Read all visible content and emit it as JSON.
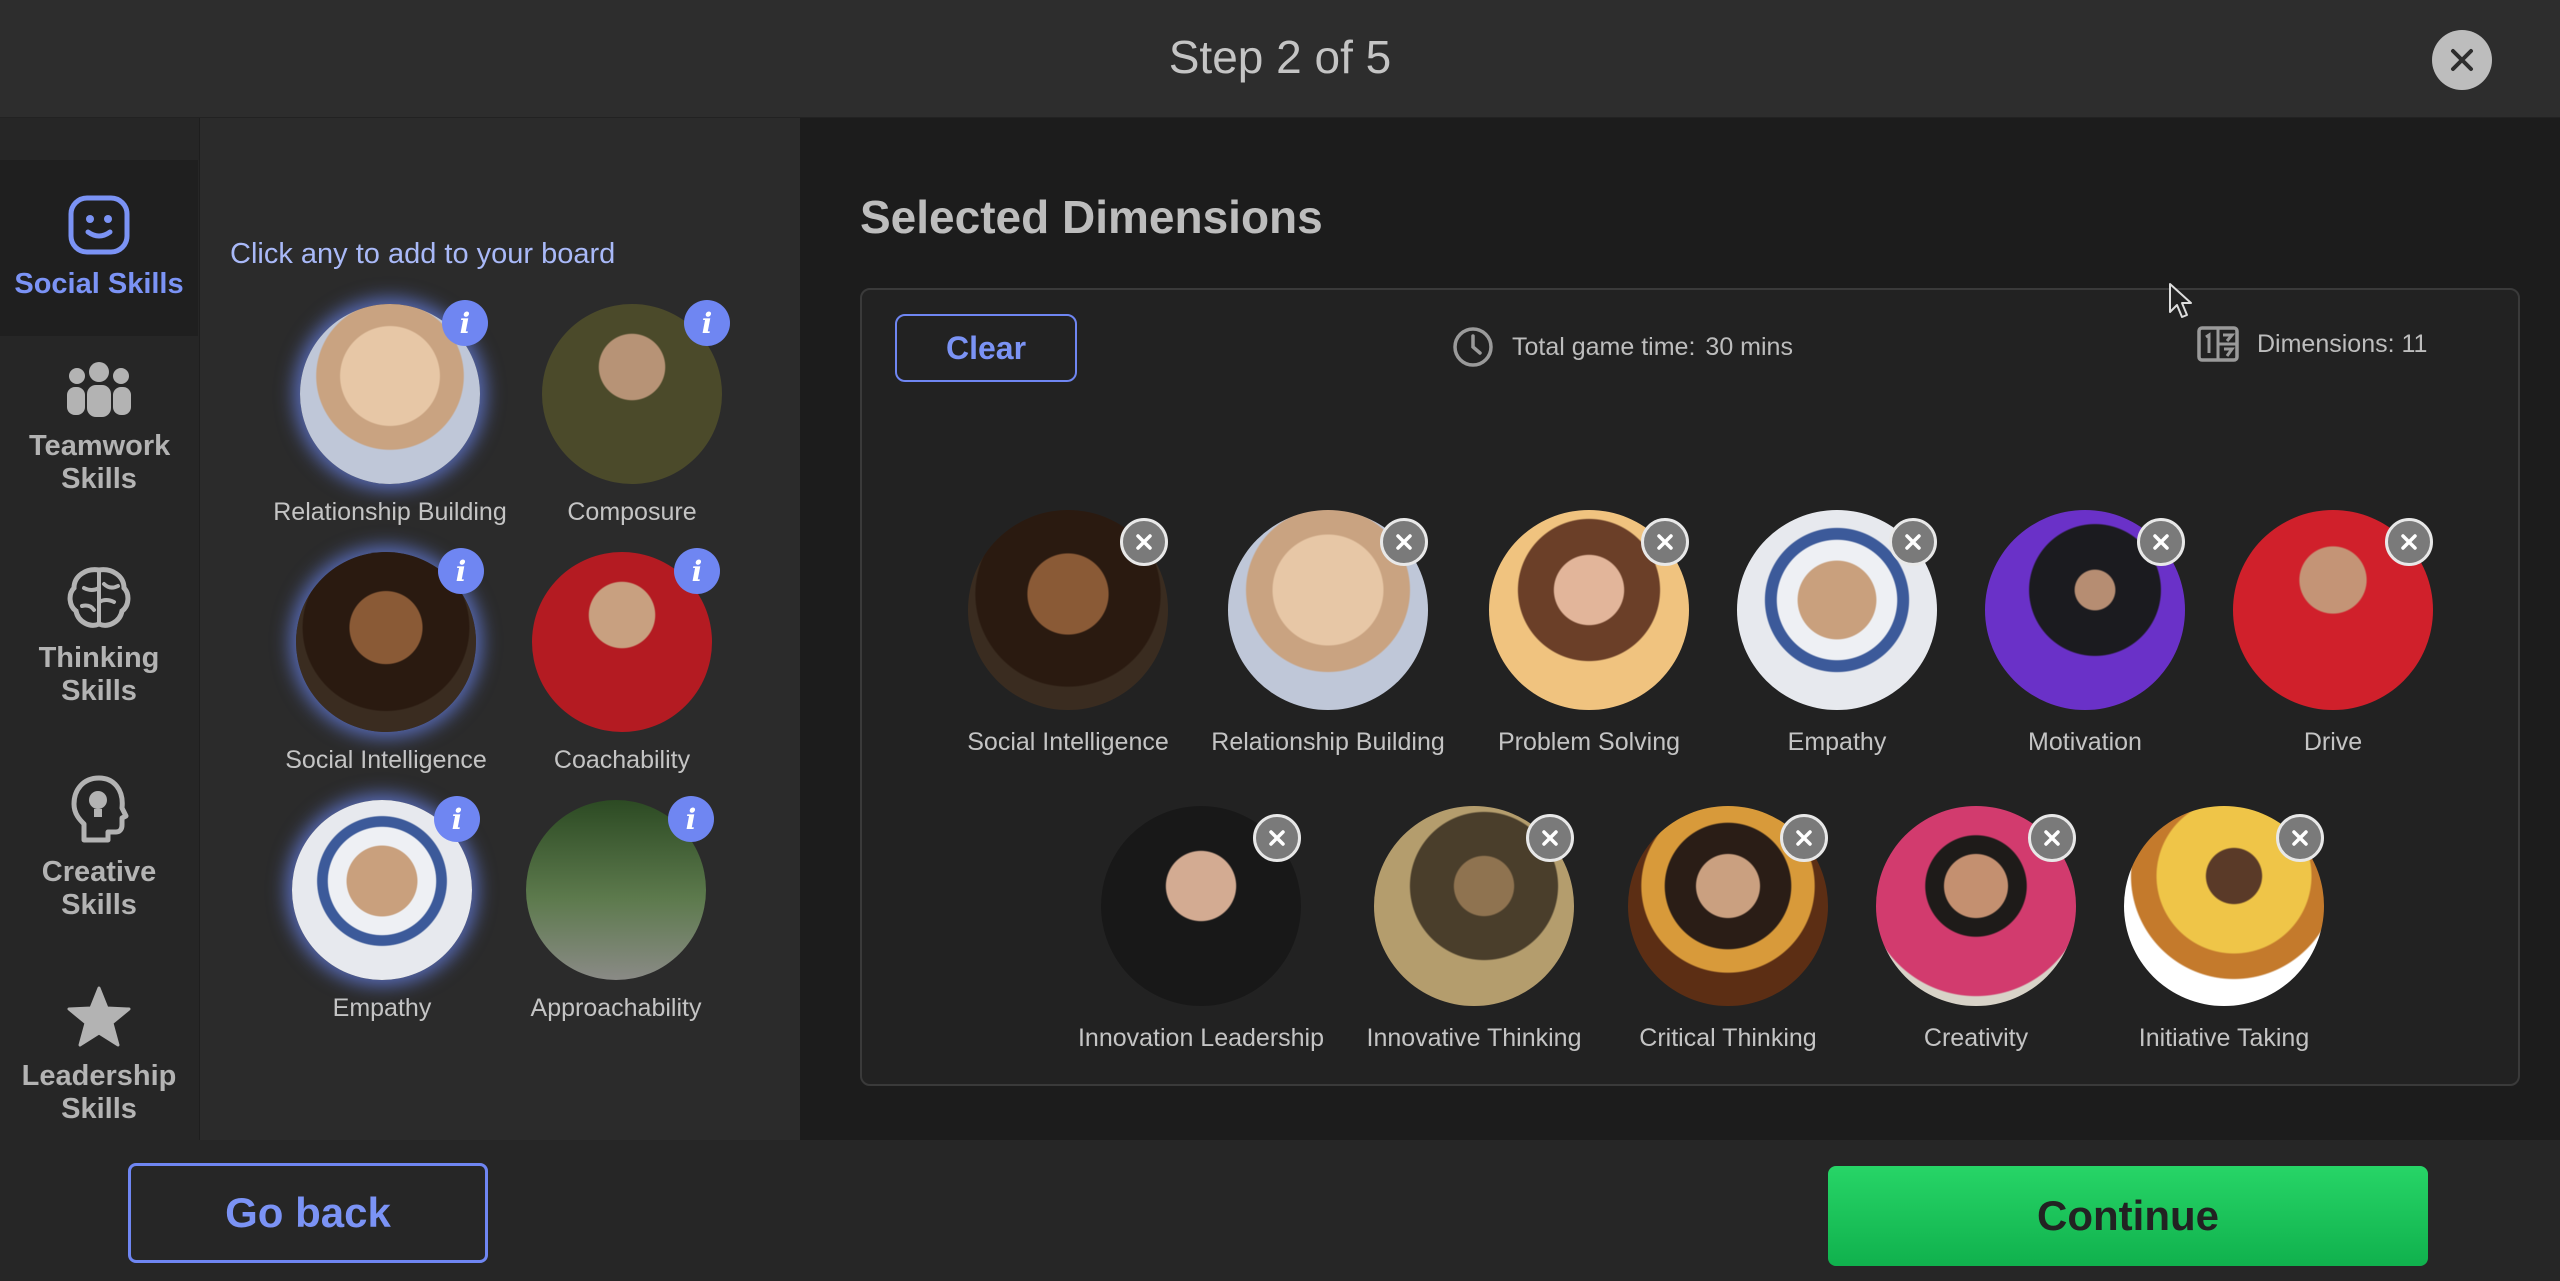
{
  "header": {
    "title": "Step 2 of 5"
  },
  "categories": [
    {
      "label": "Social Skills",
      "icon": "smile-face-icon",
      "active": true
    },
    {
      "label": "Teamwork Skills",
      "icon": "people-group-icon",
      "active": false
    },
    {
      "label": "Thinking Skills",
      "icon": "brain-icon",
      "active": false
    },
    {
      "label": "Creative Skills",
      "icon": "head-lightbulb-icon",
      "active": false
    },
    {
      "label": "Leadership Skills",
      "icon": "star-icon",
      "active": false
    }
  ],
  "picker": {
    "hint": "Click any to add to your board",
    "skills": [
      {
        "label": "Relationship Building",
        "selected": true
      },
      {
        "label": "Composure",
        "selected": false
      },
      {
        "label": "Social Intelligence",
        "selected": true
      },
      {
        "label": "Coachability",
        "selected": false
      },
      {
        "label": "Empathy",
        "selected": true
      },
      {
        "label": "Approachability",
        "selected": false
      }
    ]
  },
  "main": {
    "heading": "Selected Dimensions",
    "clear_label": "Clear",
    "total_time_label": "Total game time:",
    "total_time_value": "30 mins",
    "dimensions_label": "Dimensions: 11",
    "selected": [
      {
        "label": "Social Intelligence"
      },
      {
        "label": "Relationship Building"
      },
      {
        "label": "Problem Solving"
      },
      {
        "label": "Empathy"
      },
      {
        "label": "Motivation"
      },
      {
        "label": "Drive"
      },
      {
        "label": "Innovation Leadership"
      },
      {
        "label": "Innovative Thinking"
      },
      {
        "label": "Critical Thinking"
      },
      {
        "label": "Creativity"
      },
      {
        "label": "Initiative Taking"
      }
    ]
  },
  "footer": {
    "back_label": "Go back",
    "continue_label": "Continue"
  },
  "colors": {
    "accent": "#6f86f2",
    "continue": "#1fc95e",
    "background": "#2b2b2b"
  }
}
